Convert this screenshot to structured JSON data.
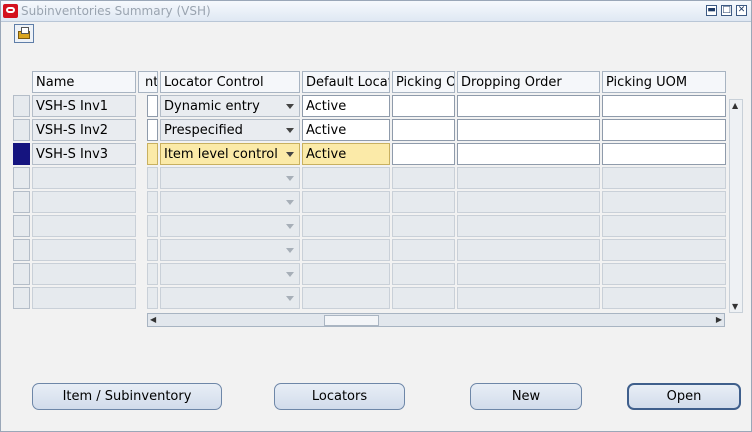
{
  "window": {
    "title": "Subinventories Summary (VSH)",
    "controls": {
      "minimize": "▬",
      "maximize": "□",
      "close": "✕"
    }
  },
  "toolbar": {
    "open_icon": "open-folder-icon"
  },
  "table": {
    "columns": {
      "name": "Name",
      "fragment": "nt",
      "locator_control": "Locator Control",
      "default_locator": "Default Locato",
      "picking_order": "Picking O",
      "dropping_order": "Dropping Order",
      "picking_uom": "Picking UOM"
    },
    "rows": [
      {
        "name": "VSH-S Inv1",
        "locator_control": "Dynamic entry",
        "default_locator": "Active",
        "picking_order": "",
        "dropping_order": "",
        "picking_uom": ""
      },
      {
        "name": "VSH-S Inv2",
        "locator_control": "Prespecified",
        "default_locator": "Active",
        "picking_order": "",
        "dropping_order": "",
        "picking_uom": ""
      },
      {
        "name": "VSH-S Inv3",
        "locator_control": "Item level control",
        "default_locator": "Active",
        "picking_order": "",
        "dropping_order": "",
        "picking_uom": ""
      }
    ],
    "current_row": 3,
    "empty_rows": 6
  },
  "buttons": {
    "item_subinventory": "Item / Subinventory",
    "locators": "Locators",
    "new": "New",
    "open": "Open"
  },
  "colors": {
    "current_row_highlight": "#fbeaa8",
    "current_record_indicator": "#15147f",
    "title_text": "#9aa4b0"
  }
}
